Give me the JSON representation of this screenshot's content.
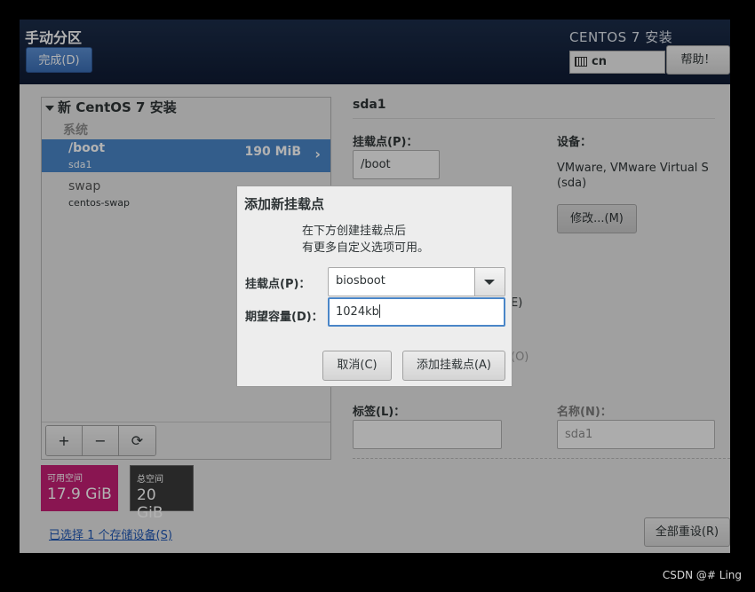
{
  "header": {
    "page_title": "手动分区",
    "done_button": "完成(D)",
    "product_title": "CENTOS 7 安装",
    "keyboard_layout": "cn",
    "help_button": "帮助！"
  },
  "tree": {
    "root_label": "新 CentOS 7 安装",
    "section_label": "系统",
    "partitions": [
      {
        "name": "/boot",
        "device": "sda1",
        "size": "190 MiB",
        "selected": true
      },
      {
        "name": "swap",
        "device": "centos-swap",
        "size": "",
        "selected": false
      }
    ],
    "tools": [
      "+",
      "−",
      "⟳"
    ]
  },
  "space": {
    "available_label": "可用空间",
    "available_value": "17.9 GiB",
    "total_label": "总空间",
    "total_value": "20 GiB"
  },
  "storage_link": "已选择 1 个存储设备(S)",
  "details": {
    "title": "sda1",
    "mount_point_label": "挂载点(P)：",
    "mount_point_value": "/boot",
    "devices_label": "设备：",
    "devices_value_line1": "VMware, VMware Virtual S",
    "devices_value_line2": "(sda)",
    "modify_button": "修改...(M)",
    "partial_text_1": "E)",
    "partial_text_2": "(O)",
    "label_label": "标签(L)：",
    "label_value": "",
    "name_label": "名称(N)：",
    "name_value": "sda1",
    "reset_button": "全部重设(R)"
  },
  "dialog": {
    "title": "添加新挂载点",
    "desc_line1": "在下方创建挂载点后",
    "desc_line2": "有更多自定义选项可用。",
    "mount_label": "挂载点(P)：",
    "mount_value": "biosboot",
    "capacity_label": "期望容量(D)：",
    "capacity_value": "1024kb",
    "cancel_button": "取消(C)",
    "add_button": "添加挂载点(A)"
  },
  "watermark": "CSDN @# Ling"
}
